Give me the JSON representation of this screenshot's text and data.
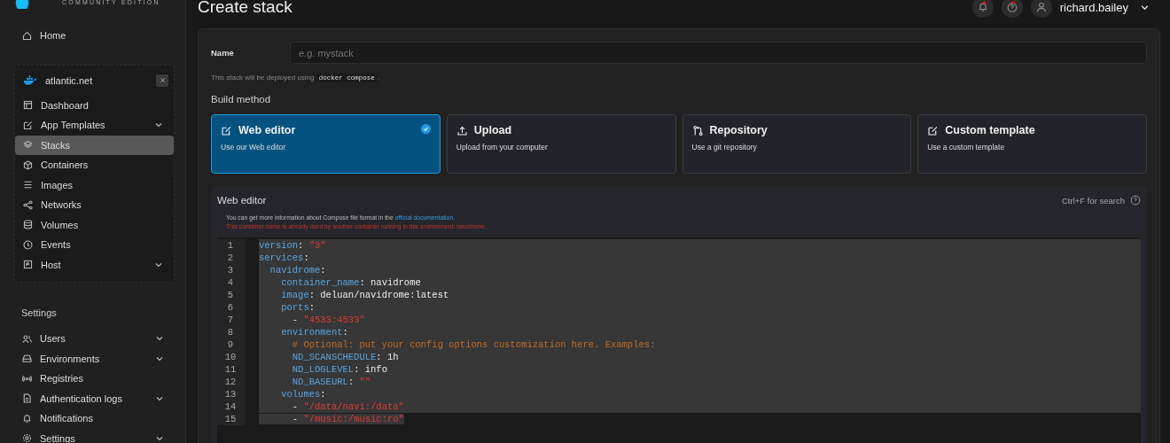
{
  "brand": {
    "edition": "COMMUNITY EDITION"
  },
  "sidebar": {
    "home": {
      "label": "Home"
    },
    "environment": {
      "name": "atlantic.net",
      "items": [
        {
          "label": "Dashboard",
          "selected": false,
          "expandable": false
        },
        {
          "label": "App Templates",
          "selected": false,
          "expandable": true
        },
        {
          "label": "Stacks",
          "selected": true,
          "expandable": false
        },
        {
          "label": "Containers",
          "selected": false,
          "expandable": false
        },
        {
          "label": "Images",
          "selected": false,
          "expandable": false
        },
        {
          "label": "Networks",
          "selected": false,
          "expandable": false
        },
        {
          "label": "Volumes",
          "selected": false,
          "expandable": false
        },
        {
          "label": "Events",
          "selected": false,
          "expandable": false
        },
        {
          "label": "Host",
          "selected": false,
          "expandable": true
        }
      ]
    },
    "settings": {
      "title": "Settings",
      "items": [
        {
          "label": "Users",
          "selected": false,
          "expandable": true
        },
        {
          "label": "Environments",
          "selected": false,
          "expandable": true
        },
        {
          "label": "Registries",
          "selected": false,
          "expandable": false
        },
        {
          "label": "Authentication logs",
          "selected": false,
          "expandable": true
        },
        {
          "label": "Notifications",
          "selected": false,
          "expandable": false
        },
        {
          "label": "Settings",
          "selected": false,
          "expandable": true
        }
      ]
    }
  },
  "header": {
    "title": "Create stack",
    "user": "richard.bailey"
  },
  "form": {
    "name_label": "Name",
    "name_placeholder": "e.g. mystack",
    "hint_before": "This stack will be deployed using",
    "hint_code": "docker compose",
    "hint_after": ".",
    "build_method_title": "Build method",
    "methods": [
      {
        "title": "Web editor",
        "subtitle": "Use our Web editor",
        "selected": true
      },
      {
        "title": "Upload",
        "subtitle": "Upload from your computer",
        "selected": false
      },
      {
        "title": "Repository",
        "subtitle": "Use a git repository",
        "selected": false
      },
      {
        "title": "Custom template",
        "subtitle": "Use a custom template",
        "selected": false
      }
    ]
  },
  "editor": {
    "title": "Web editor",
    "search_hint": "Ctrl+F for search",
    "info_before": "You can get more information about Compose file format in the",
    "info_link": "official documentation",
    "info_after": ".",
    "warning": "This container name is already used by another container running in this environment: navidrome.",
    "lines": [
      {
        "number": "1",
        "selected": true,
        "tokens": [
          {
            "kind": "key",
            "text": "version"
          },
          {
            "kind": "plain",
            "text": ": "
          },
          {
            "kind": "string",
            "text": "\"3\""
          }
        ]
      },
      {
        "number": "2",
        "selected": true,
        "tokens": [
          {
            "kind": "key",
            "text": "services"
          },
          {
            "kind": "plain",
            "text": ":"
          }
        ]
      },
      {
        "number": "3",
        "selected": true,
        "tokens": [
          {
            "kind": "key",
            "text": "  navidrome"
          },
          {
            "kind": "plain",
            "text": ":"
          }
        ]
      },
      {
        "number": "4",
        "selected": true,
        "tokens": [
          {
            "kind": "key",
            "text": "    container_name"
          },
          {
            "kind": "plain",
            "text": ": navidrome"
          }
        ]
      },
      {
        "number": "5",
        "selected": true,
        "tokens": [
          {
            "kind": "key",
            "text": "    image"
          },
          {
            "kind": "plain",
            "text": ": deluan/navidrome:latest"
          }
        ]
      },
      {
        "number": "6",
        "selected": true,
        "tokens": [
          {
            "kind": "key",
            "text": "    ports"
          },
          {
            "kind": "plain",
            "text": ":"
          }
        ]
      },
      {
        "number": "7",
        "selected": true,
        "tokens": [
          {
            "kind": "plain",
            "text": "      - "
          },
          {
            "kind": "string",
            "text": "\"4533:4533\""
          }
        ]
      },
      {
        "number": "8",
        "selected": true,
        "tokens": [
          {
            "kind": "key",
            "text": "    environment"
          },
          {
            "kind": "plain",
            "text": ":"
          }
        ]
      },
      {
        "number": "9",
        "selected": true,
        "tokens": [
          {
            "kind": "comment",
            "text": "      # Optional: put your config options customization here. Examples:"
          }
        ]
      },
      {
        "number": "10",
        "selected": true,
        "tokens": [
          {
            "kind": "key",
            "text": "      ND_SCANSCHEDULE"
          },
          {
            "kind": "plain",
            "text": ": 1h"
          }
        ]
      },
      {
        "number": "11",
        "selected": true,
        "tokens": [
          {
            "kind": "key",
            "text": "      ND_LOGLEVEL"
          },
          {
            "kind": "plain",
            "text": ": info"
          }
        ]
      },
      {
        "number": "12",
        "selected": true,
        "tokens": [
          {
            "kind": "key",
            "text": "      ND_BASEURL"
          },
          {
            "kind": "plain",
            "text": ": "
          },
          {
            "kind": "string",
            "text": "\"\""
          }
        ]
      },
      {
        "number": "13",
        "selected": true,
        "tokens": [
          {
            "kind": "key",
            "text": "    volumes"
          },
          {
            "kind": "plain",
            "text": ":"
          }
        ]
      },
      {
        "number": "14",
        "selected": true,
        "tokens": [
          {
            "kind": "plain",
            "text": "      - "
          },
          {
            "kind": "string",
            "text": "\"/data/navi:/data\""
          }
        ]
      },
      {
        "number": "15",
        "selected": true,
        "tokens": [
          {
            "kind": "plain",
            "text": "      - "
          },
          {
            "kind": "string",
            "text": "\"/music:/music:ro\""
          }
        ]
      }
    ]
  }
}
